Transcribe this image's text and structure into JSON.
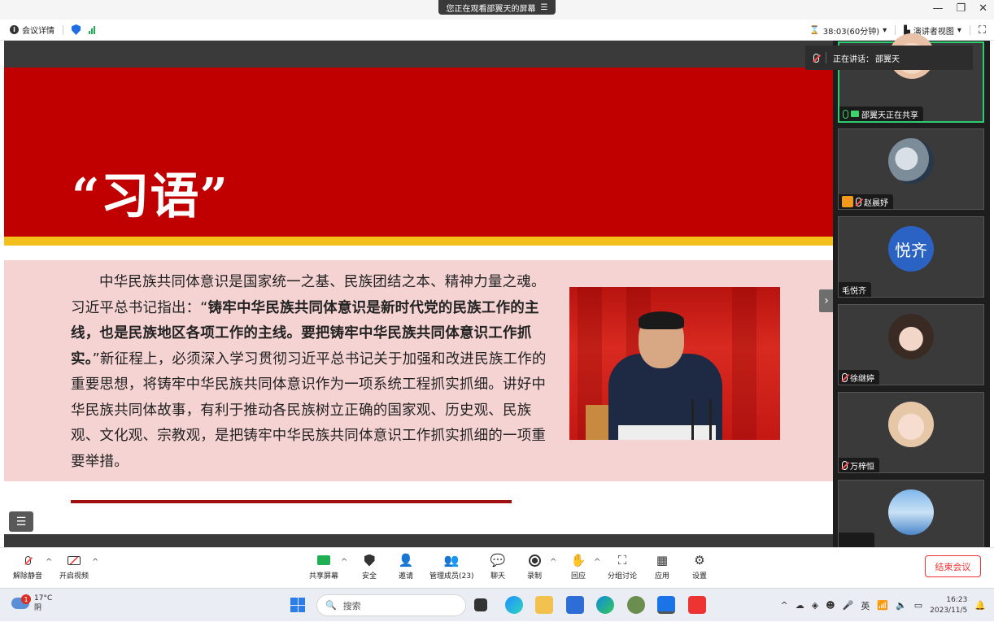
{
  "titlebar": {
    "share_banner": "您正在观看邵翼天的屏幕",
    "banner_menu_icon": "menu-icon",
    "minimize": "—",
    "restore": "❐",
    "close": "✕"
  },
  "infobar": {
    "meeting_info": "会议详情",
    "timer": "38:03(60分钟)",
    "view_mode": "演讲者视图",
    "fullscreen_icon": "⛶"
  },
  "slide": {
    "title": "“习语”",
    "paragraph_part1": "中华民族共同体意识是国家统一之基、民族团结之本、精神力量之魂。习近平总书记指出：“",
    "paragraph_bold": "铸牢中华民族共同体意识是新时代党的民族工作的主线，也是民族地区各项工作的主线。要把铸牢中华民族共同体意识工作抓实。",
    "paragraph_part2": "”新征程上，必须深入学习贯彻习近平总书记关于加强和改进民族工作的重要思想，将铸牢中华民族共同体意识作为一项系统工程抓实抓细。讲好中华民族共同体故事，有利于推动各民族树立正确的国家观、历史观、民族观、文化观、宗教观，是把铸牢中华民族共同体意识工作抓实抓细的一项重要举措。"
  },
  "speaker": {
    "label": "正在讲话：",
    "name": "邵翼天"
  },
  "gallery": {
    "participants": [
      {
        "name": "邵翼天正在共享"
      },
      {
        "name": "赵晨妤"
      },
      {
        "name": "毛悦齐",
        "initials": "悦齐"
      },
      {
        "name": "徐继婷"
      },
      {
        "name": "万梓恒"
      },
      {
        "name": ""
      }
    ]
  },
  "toolbar": {
    "unmute": "解除静音",
    "start_video": "开启视频",
    "share_screen": "共享屏幕",
    "security": "安全",
    "invite": "邀请",
    "participants": "管理成员(23)",
    "chat": "聊天",
    "record": "录制",
    "reactions": "回应",
    "breakout": "分组讨论",
    "apps": "应用",
    "settings": "设置",
    "end_meeting": "结束会议"
  },
  "taskbar": {
    "weather_temp": "17°C",
    "weather_desc": "阴",
    "weather_badge": "1",
    "search_placeholder": "搜索",
    "ime": "英",
    "time": "16:23",
    "date": "2023/11/5"
  },
  "colors": {
    "slide_red": "#c00000",
    "slide_yellow": "#f3c01b",
    "slide_pink": "#f6d3d3",
    "active_speaker_border": "#2ecc71",
    "end_button": "#e33333",
    "avatar_blue": "#2a63c4"
  }
}
